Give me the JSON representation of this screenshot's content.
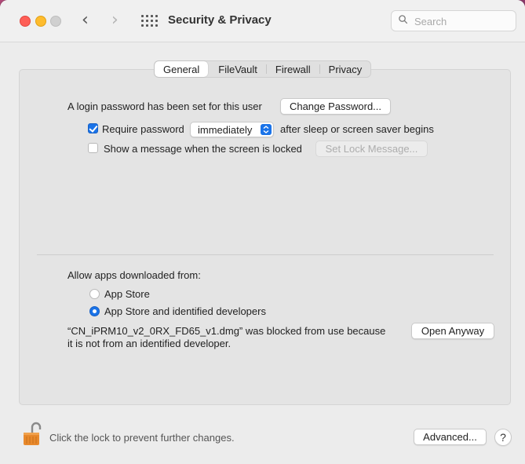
{
  "window": {
    "title": "Security & Privacy",
    "search_placeholder": "Search"
  },
  "tabs": [
    "General",
    "FileVault",
    "Firewall",
    "Privacy"
  ],
  "active_tab": "General",
  "general": {
    "login_text": "A login password has been set for this user",
    "change_password_label": "Change Password...",
    "require_password_label": "Require password",
    "require_password_checked": true,
    "require_password_value": "immediately",
    "after_sleep_text": "after sleep or screen saver begins",
    "show_message_label": "Show a message when the screen is locked",
    "show_message_checked": false,
    "set_lock_message_label": "Set Lock Message..."
  },
  "apps": {
    "heading": "Allow apps downloaded from:",
    "option_app_store": "App Store",
    "option_identified": "App Store and identified developers",
    "selected": "App Store and identified developers",
    "blocked_line1": "“CN_iPRM10_v2_0RX_FD65_v1.dmg” was blocked from use because",
    "blocked_line2": "it is not from an identified developer.",
    "open_anyway_label": "Open Anyway"
  },
  "footer": {
    "lock_text": "Click the lock to prevent further changes.",
    "advanced_label": "Advanced...",
    "help_label": "?"
  },
  "colors": {
    "accent": "#1a73e8",
    "close": "#fe5f57",
    "minimize": "#febc2e",
    "lock": "#e8892c"
  }
}
